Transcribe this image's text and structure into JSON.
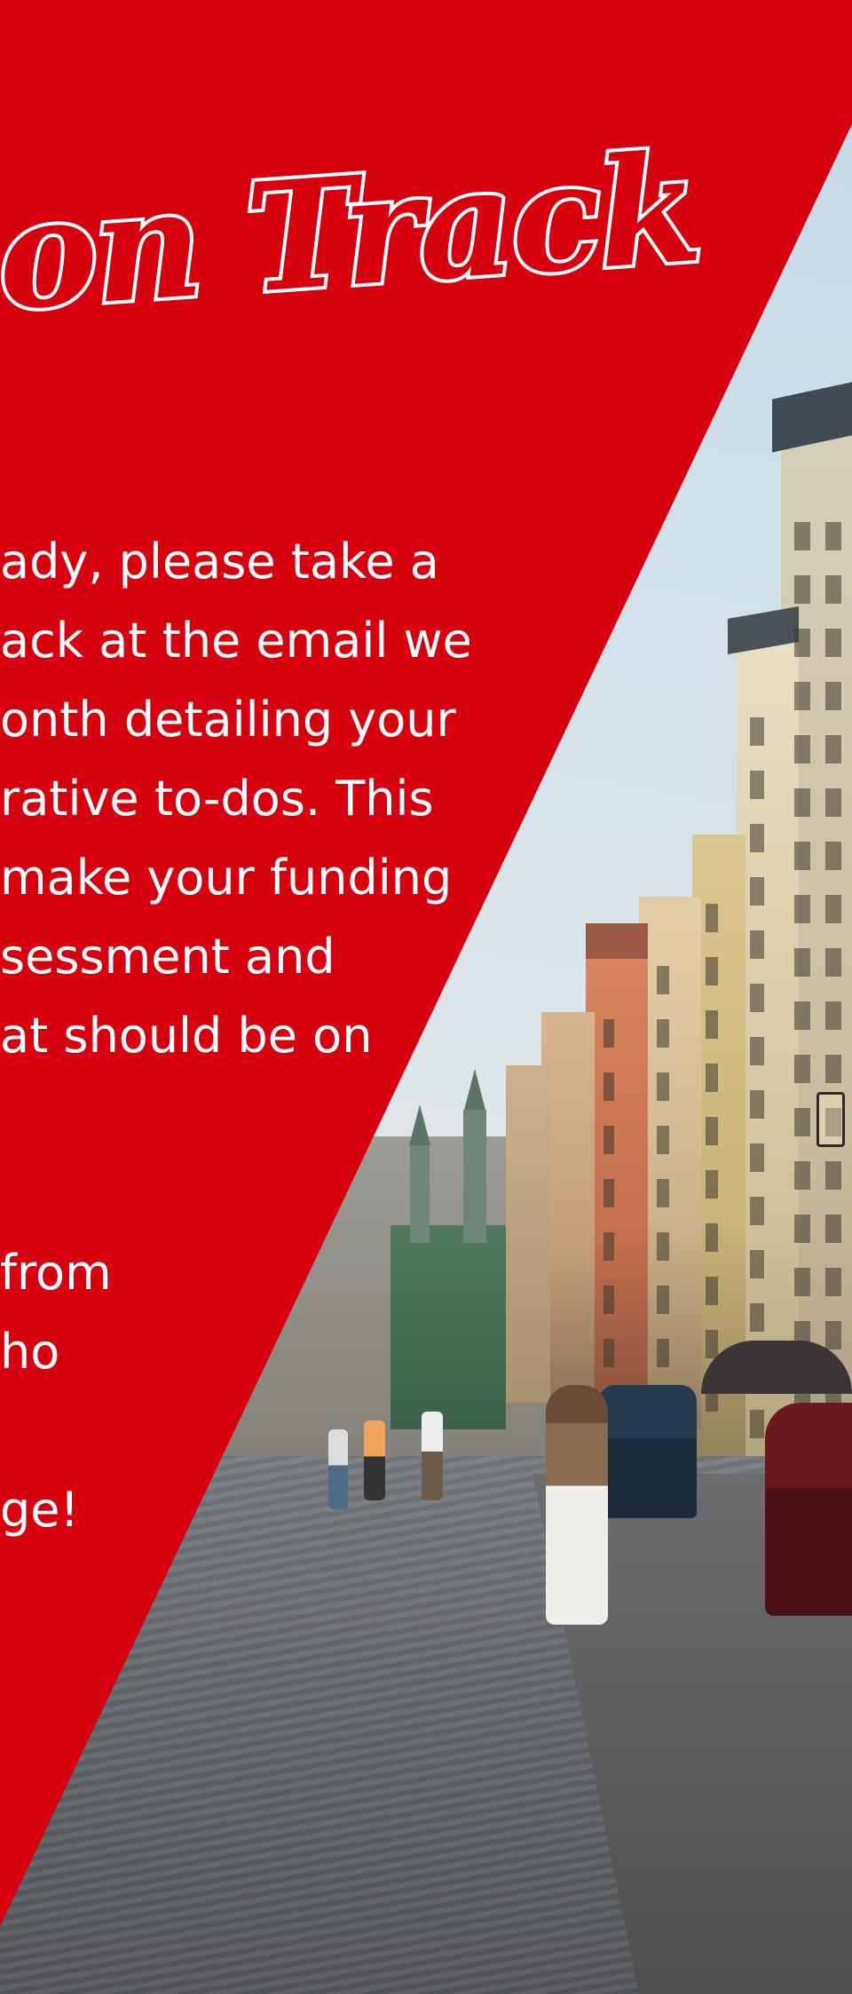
{
  "headline": "y on Track",
  "body_lines": [
    "ady, please take a",
    "ack at the email we",
    "onth detailing your",
    "rative to-dos. This",
    " make your funding",
    "sessment and",
    "at should be on",
    "",
    "",
    "from",
    "ho",
    "",
    "ge!"
  ],
  "colors": {
    "panel_red": "#d7000f",
    "text_white": "#ffffff"
  }
}
